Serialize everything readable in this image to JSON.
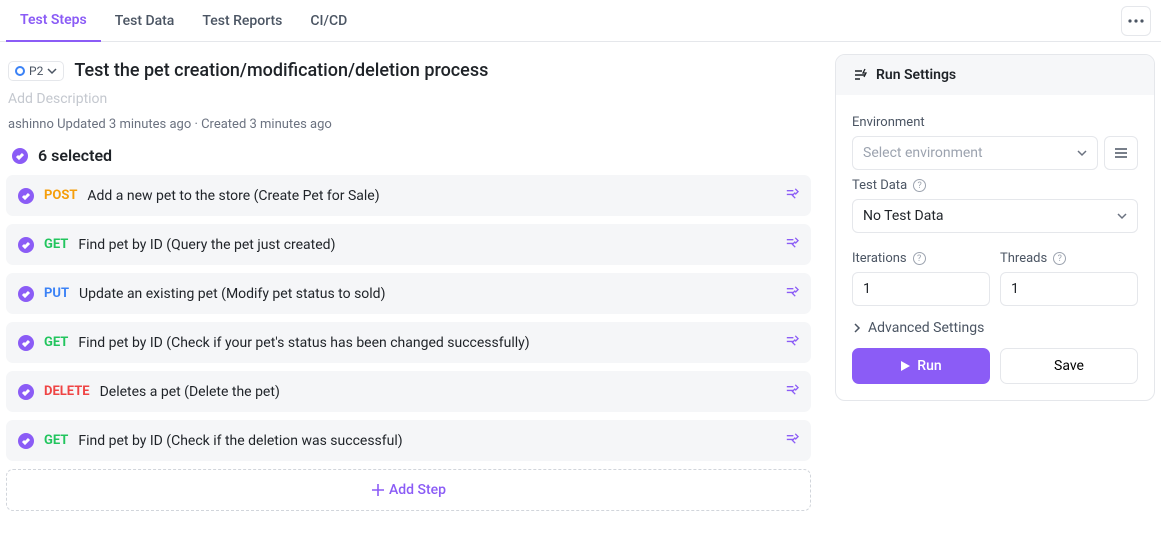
{
  "tabs": [
    "Test Steps",
    "Test Data",
    "Test Reports",
    "CI/CD"
  ],
  "activeTab": "Test Steps",
  "priority": "P2",
  "title": "Test the pet creation/modification/deletion process",
  "descriptionPlaceholder": "Add Description",
  "meta": "ashinno Updated 3 minutes ago · Created 3 minutes ago",
  "selectedText": "6 selected",
  "steps": [
    {
      "method": "POST",
      "cls": "m-post",
      "label": "Add a new pet to the store (Create Pet for Sale)"
    },
    {
      "method": "GET",
      "cls": "m-get",
      "label": "Find pet by ID (Query the pet just created)"
    },
    {
      "method": "PUT",
      "cls": "m-put",
      "label": "Update an existing pet (Modify pet status to sold)"
    },
    {
      "method": "GET",
      "cls": "m-get",
      "label": "Find pet by ID (Check if your pet's status has been changed successfully)"
    },
    {
      "method": "DELETE",
      "cls": "m-delete",
      "label": "Deletes a pet (Delete the pet)"
    },
    {
      "method": "GET",
      "cls": "m-get",
      "label": "Find pet by ID (Check if the deletion was successful)"
    }
  ],
  "addStep": "Add Step",
  "runSettings": {
    "title": "Run Settings",
    "environmentLabel": "Environment",
    "environmentPlaceholder": "Select environment",
    "testDataLabel": "Test Data",
    "testDataValue": "No Test Data",
    "iterationsLabel": "Iterations",
    "iterationsValue": "1",
    "threadsLabel": "Threads",
    "threadsValue": "1",
    "advanced": "Advanced Settings",
    "run": "Run",
    "save": "Save"
  }
}
